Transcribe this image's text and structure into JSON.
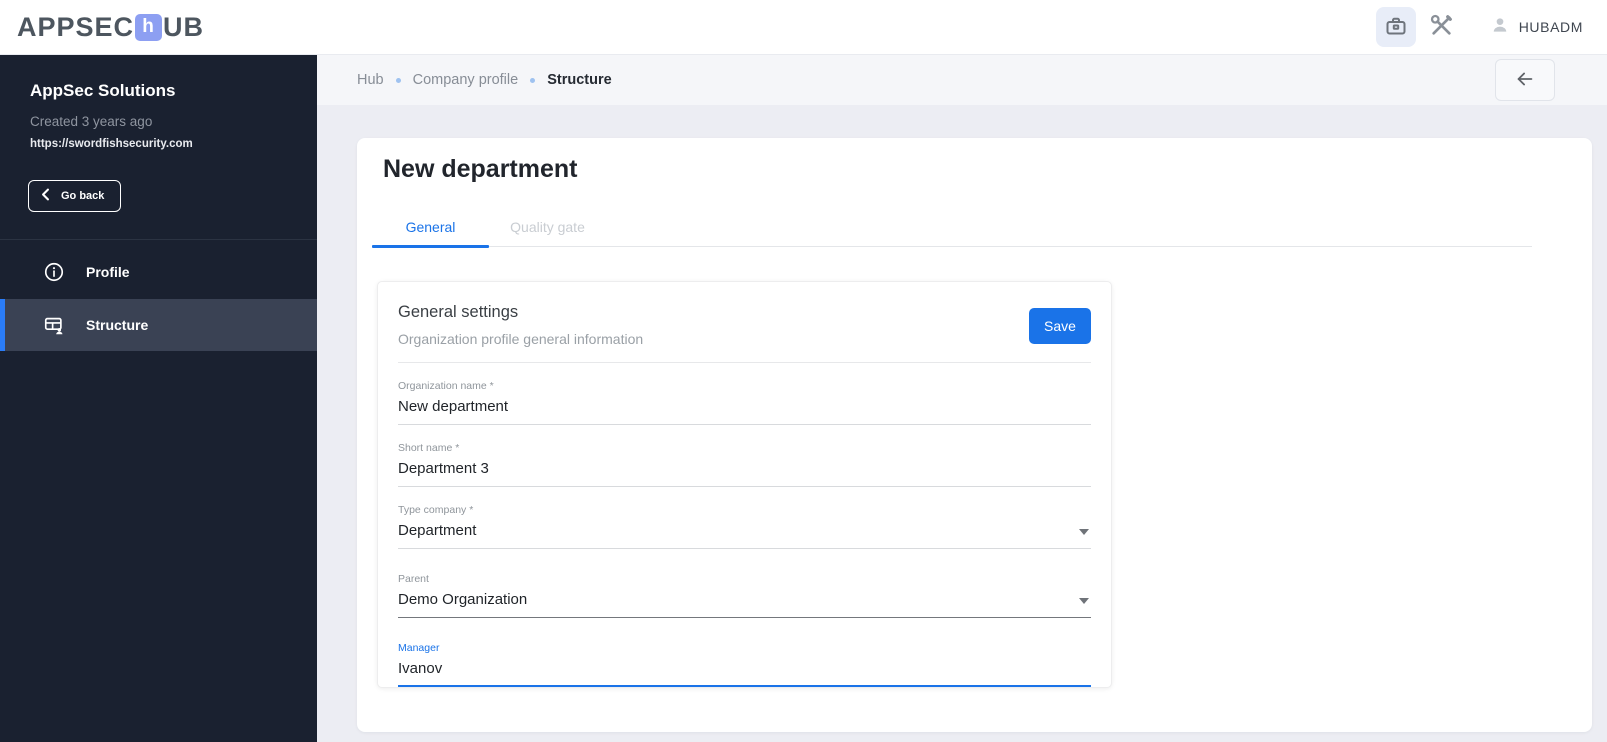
{
  "header": {
    "logo_prefix": "APPSEC",
    "logo_icon_letter": "h",
    "logo_suffix": "UB",
    "username": "HUBADM"
  },
  "breadcrumb": {
    "items": [
      "Hub",
      "Company profile",
      "Structure"
    ]
  },
  "sidebar": {
    "org_name": "AppSec Solutions",
    "created": "Created 3 years ago",
    "url": "https://swordfishsecurity.com",
    "go_back_label": "Go back",
    "items": [
      {
        "label": "Profile",
        "icon": "info-icon",
        "selected": false
      },
      {
        "label": "Structure",
        "icon": "org-structure-icon",
        "selected": true
      }
    ]
  },
  "main": {
    "title": "New department",
    "tabs": [
      {
        "label": "General",
        "active": true
      },
      {
        "label": "Quality gate",
        "active": false
      }
    ],
    "card": {
      "title": "General settings",
      "subtitle": "Organization profile general information",
      "save_label": "Save",
      "fields": [
        {
          "label": "Organization name *",
          "value": "New department",
          "type": "text"
        },
        {
          "label": "Short name *",
          "value": "Department 3",
          "type": "text"
        },
        {
          "label": "Type company *",
          "value": "Department",
          "type": "select"
        },
        {
          "label": "Parent",
          "value": "Demo Organization",
          "type": "select"
        },
        {
          "label": "Manager",
          "value": "Ivanov",
          "type": "text",
          "focused": true
        }
      ]
    }
  },
  "colors": {
    "accent": "#1a73e8",
    "sidebar_bg": "#1a2130",
    "sidebar_selected_bg": "#3a4254",
    "sidebar_selected_bar": "#2a7cf7",
    "logo_icon_bg": "#8d9ff2",
    "content_bg": "#ecedf3",
    "breadcrumb_bar_bg": "#f5f6f9",
    "briefcase_btn_bg": "#e8edf8"
  }
}
